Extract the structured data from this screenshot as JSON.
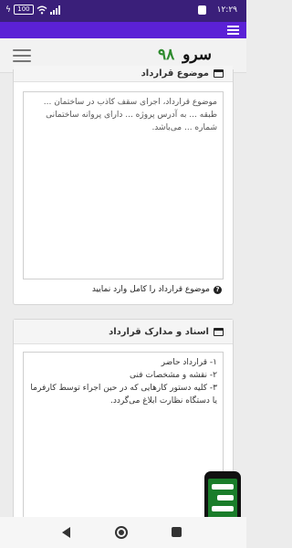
{
  "status_bar": {
    "time": "۱۲:۲۹",
    "battery": "100"
  },
  "header": {
    "logo_word": "سرو",
    "logo_number": "۹۸",
    "menu_icon": "hamburger-icon"
  },
  "contract_subject": {
    "title": "موضوع قرارداد",
    "value": "موضوع قرارداد، اجرای سقف کاذب در ساختمان ... طبقه ... به آدرس پروژه ... دارای پروانه ساختمانی شماره ... می‌باشد.",
    "hint": "موضوع قرارداد را کامل وارد نمایید",
    "icon": "window-icon",
    "hint_icon": "question-circle-icon"
  },
  "contract_documents": {
    "title": "اسناد و مدارک قرارداد",
    "value": "۱- قرارداد حاضر\n۲- نقشه و مشخصات فنی\n۳- کلیه دستور کارهایی که در حین اجراء توسط کارفرما یا دستگاه نظارت ابلاغ می‌گردد.",
    "icon": "window-icon"
  },
  "nav_bar": {
    "back": "back-triangle-icon",
    "home": "home-circle-icon",
    "recent": "recent-square-icon"
  }
}
